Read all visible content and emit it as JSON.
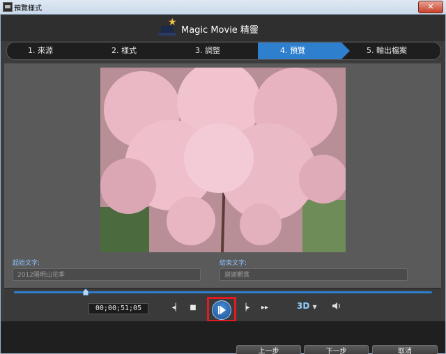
{
  "window": {
    "title": "預覽樣式",
    "close_label": "✕"
  },
  "header": {
    "product_name": "Magic Movie 精靈"
  },
  "steps": [
    {
      "label": "1. 來源",
      "active": false
    },
    {
      "label": "2. 樣式",
      "active": false
    },
    {
      "label": "3. 調整",
      "active": false
    },
    {
      "label": "4. 預覽",
      "active": true
    },
    {
      "label": "5. 輸出檔案",
      "active": false
    }
  ],
  "fields": {
    "start_label": "起始文字:",
    "start_value": "2012陽明山花季",
    "end_label": "結束文字:",
    "end_value": "謝謝觀賞"
  },
  "player": {
    "timecode": "00;00;51;05",
    "progress": 0.17,
    "badge_3d": "3D"
  },
  "footer": {
    "back_label": "上一步",
    "next_label": "下一步",
    "cancel_label": "取消"
  },
  "colors": {
    "accent": "#2f7fcf",
    "highlight": "#e01b24",
    "bg_dark": "#3c3c3c"
  }
}
